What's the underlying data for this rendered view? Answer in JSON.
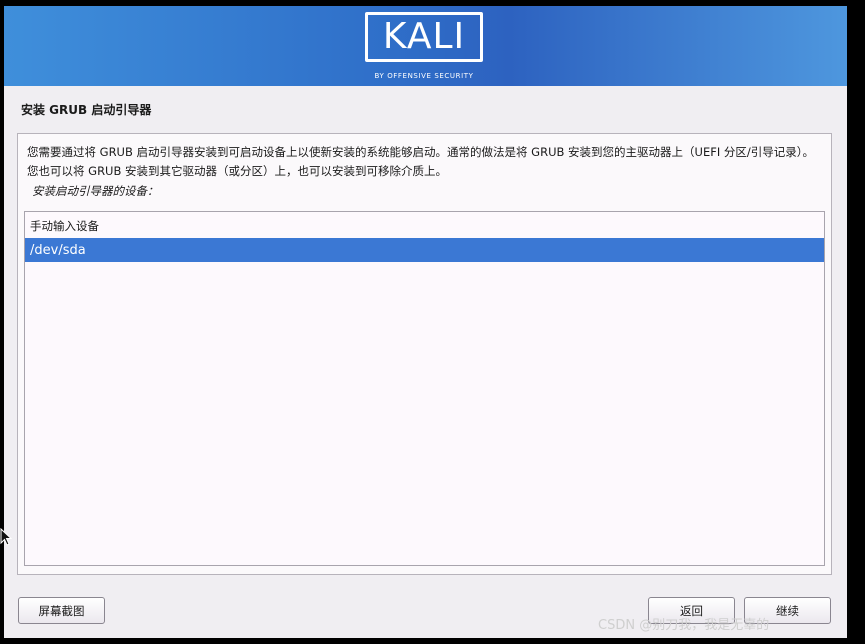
{
  "header": {
    "logo_text": "KALI",
    "logo_subtitle": "BY OFFENSIVE SECURITY"
  },
  "page": {
    "title": "安装 GRUB 启动引导器",
    "description": "您需要通过将 GRUB 启动引导器安装到可启动设备上以使新安装的系统能够启动。通常的做法是将 GRUB 安装到您的主驱动器上（UEFI 分区/引导记录）。您也可以将 GRUB 安装到其它驱动器（或分区）上，也可以安装到可移除介质上。",
    "prompt": "安装启动引导器的设备："
  },
  "device_list": {
    "items": [
      {
        "label": "手动输入设备"
      },
      {
        "label": "/dev/sda"
      }
    ],
    "selected": "/dev/sda"
  },
  "buttons": {
    "screenshot": "屏幕截图",
    "back": "返回",
    "continue": "继续"
  },
  "watermark": "CSDN @别刀我，我是无辜的",
  "colors": {
    "banner": "#2f6fc9",
    "selection": "#3b78d4",
    "background": "#f0eef2"
  },
  "icons": {
    "cursor": "mouse-pointer-icon"
  }
}
